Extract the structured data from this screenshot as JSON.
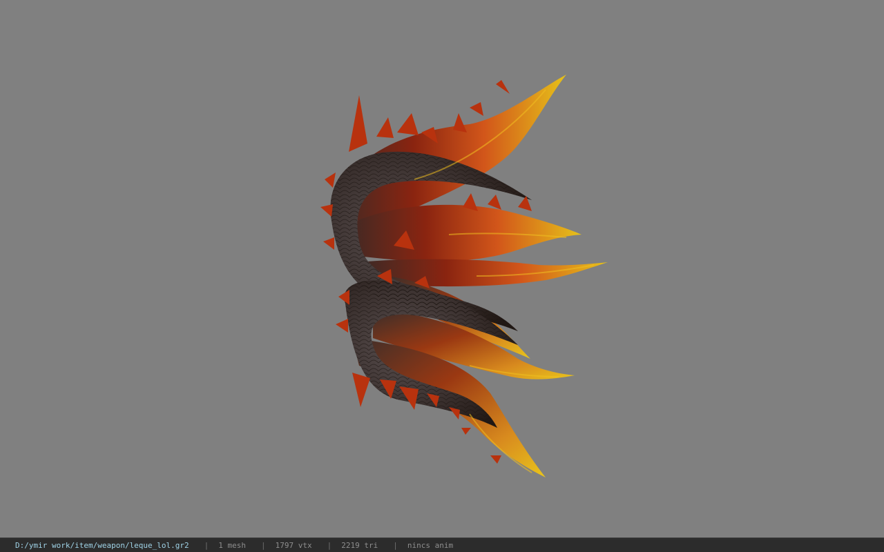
{
  "viewport": {
    "background": "#808080",
    "model_icon": "dragon-wing-fan-model"
  },
  "status": {
    "path": "D:/ymir work/item/weapon/leque_lol.gr2",
    "mesh": "1 mesh",
    "vtx": "1797 vtx",
    "tri": "2219 tri",
    "anim": "nincs anim",
    "separator": "|"
  },
  "colors": {
    "path": "#9fd2e6",
    "status_bg": "#2c2c2c",
    "status_text": "#8e8e8e"
  }
}
